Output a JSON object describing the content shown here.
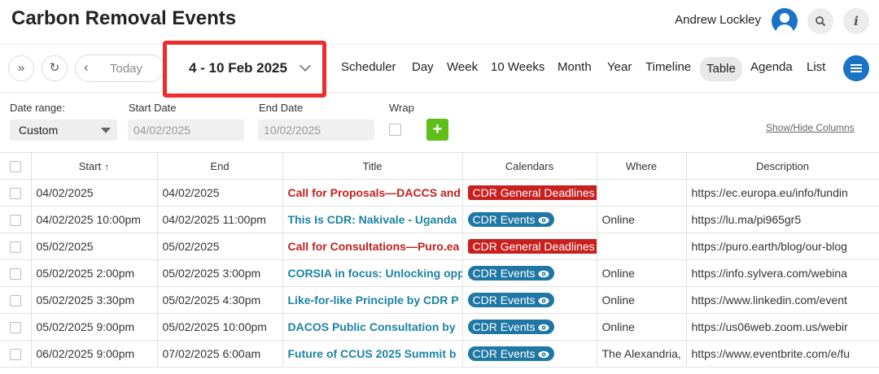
{
  "header": {
    "title": "Carbon Removal Events",
    "user_name": "Andrew Lockley",
    "icons": {
      "avatar": "user-avatar-icon",
      "search": "search-icon",
      "info": "info-icon"
    }
  },
  "toolbar": {
    "today_label": "Today",
    "date_range_label": "4 - 10 Feb 2025",
    "views": [
      "Scheduler",
      "Day",
      "Week",
      "10 Weeks",
      "Month",
      "Year",
      "Timeline",
      "Table",
      "Agenda",
      "List"
    ],
    "active_view": "Table",
    "colors": {
      "highlight": "#ee2c2c",
      "menu": "#1a73c5"
    }
  },
  "filters": {
    "date_range_label": "Date range:",
    "date_range_value": "Custom",
    "start_date_label": "Start Date",
    "start_date_value": "04/02/2025",
    "end_date_label": "End Date",
    "end_date_value": "10/02/2025",
    "wrap_label": "Wrap",
    "show_hide_label": "Show/Hide Columns"
  },
  "table": {
    "columns": [
      "Start",
      "End",
      "Title",
      "Calendars",
      "Where",
      "Description"
    ],
    "sort_indicator": "↑",
    "rows": [
      {
        "start": "04/02/2025",
        "end": "04/02/2025",
        "title": "Call for Proposals—DACCS and",
        "title_color": "red",
        "calendar": "CDR General Deadlines",
        "calendar_type": "deadline",
        "where": "",
        "description": "https://ec.europa.eu/info/fundin"
      },
      {
        "start": "04/02/2025 10:00pm",
        "end": "04/02/2025 11:00pm",
        "title": "This Is CDR: Nakivale - Uganda",
        "title_color": "teal",
        "calendar": "CDR Events",
        "calendar_type": "event",
        "where": "Online",
        "description": "https://lu.ma/pi965gr5"
      },
      {
        "start": "05/02/2025",
        "end": "05/02/2025",
        "title": "Call for Consultations—Puro.ea",
        "title_color": "red",
        "calendar": "CDR General Deadlines",
        "calendar_type": "deadline",
        "where": "",
        "description": "https://puro.earth/blog/our-blog"
      },
      {
        "start": "05/02/2025 2:00pm",
        "end": "05/02/2025 3:00pm",
        "title": "CORSIA in focus: Unlocking opp",
        "title_color": "teal",
        "calendar": "CDR Events",
        "calendar_type": "event",
        "where": "Online",
        "description": "https://info.sylvera.com/webina"
      },
      {
        "start": "05/02/2025 3:30pm",
        "end": "05/02/2025 4:30pm",
        "title": "Like-for-like Principle by CDR P",
        "title_color": "teal",
        "calendar": "CDR Events",
        "calendar_type": "event",
        "where": "Online",
        "description": "https://www.linkedin.com/event"
      },
      {
        "start": "05/02/2025 9:00pm",
        "end": "05/02/2025 10:00pm",
        "title": "DACOS Public Consultation by",
        "title_color": "teal",
        "calendar": "CDR Events",
        "calendar_type": "event",
        "where": "Online",
        "description": "https://us06web.zoom.us/webir"
      },
      {
        "start": "06/02/2025 9:00pm",
        "end": "07/02/2025 6:00am",
        "title": "Future of CCUS 2025 Summit b",
        "title_color": "teal",
        "calendar": "CDR Events",
        "calendar_type": "event",
        "where": "The Alexandria,",
        "description": "https://www.eventbrite.com/e/fu"
      }
    ],
    "colors": {
      "deadline_badge": "#c91f1f",
      "event_badge": "#1f77a5",
      "title_red": "#c0211f",
      "title_teal": "#1c83a3"
    }
  }
}
